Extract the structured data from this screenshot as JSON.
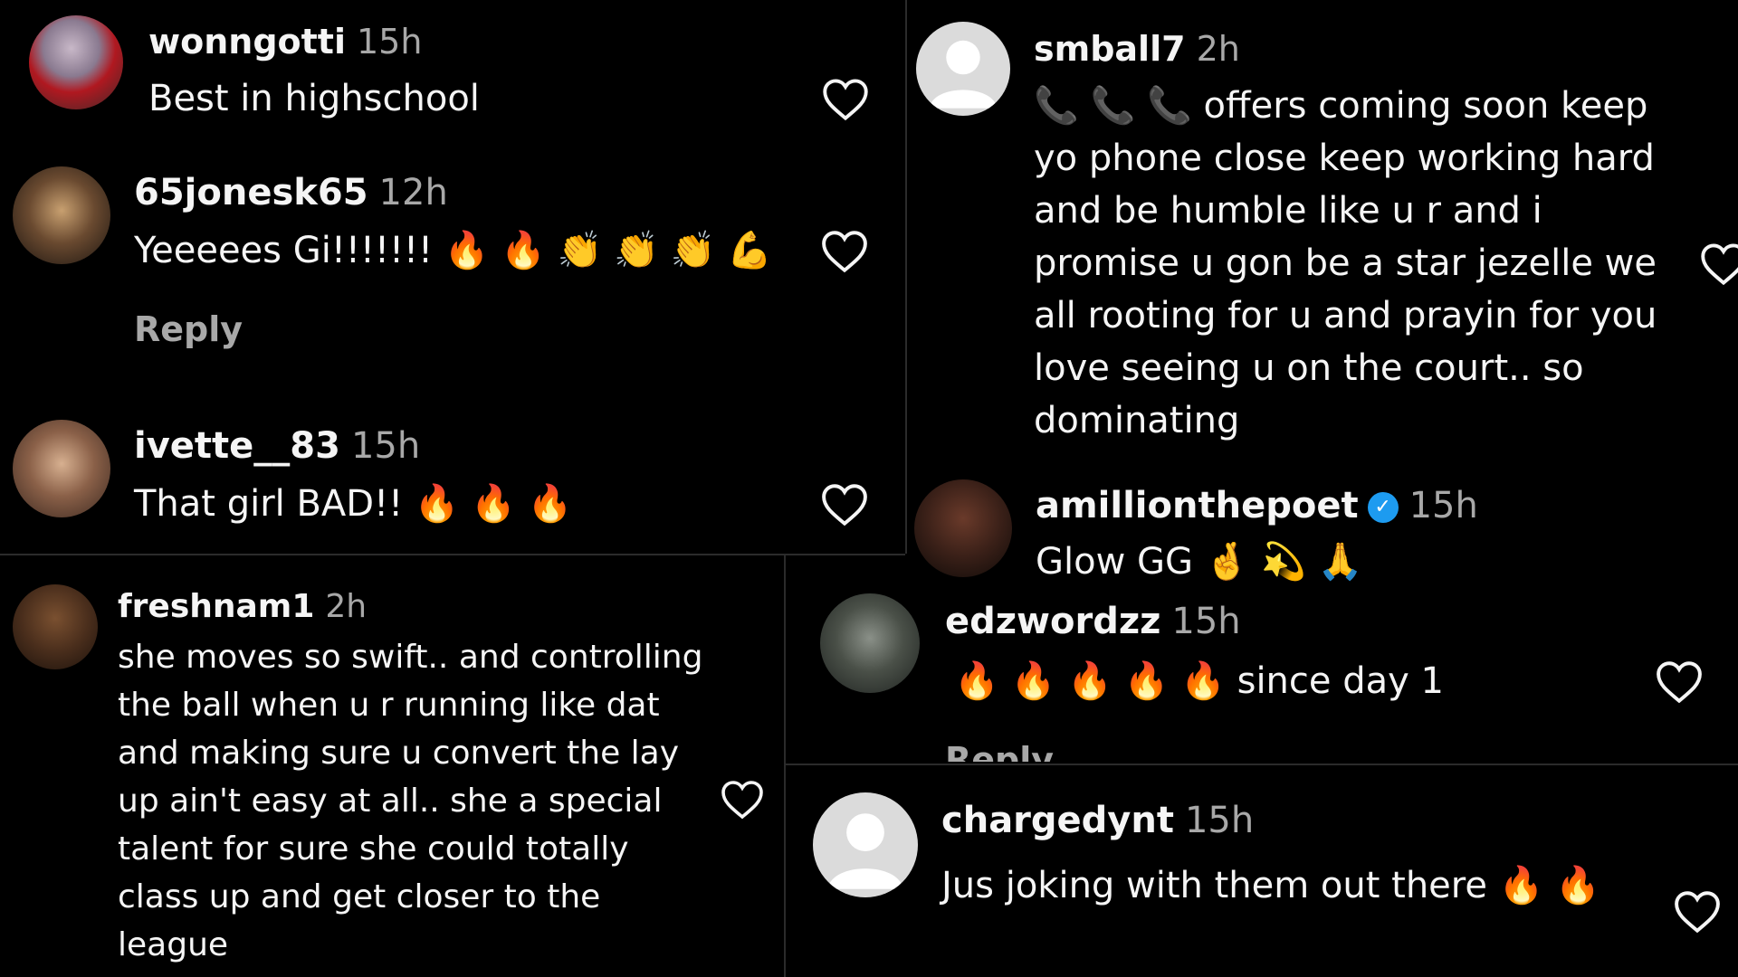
{
  "comments": [
    {
      "username": "wonngotti",
      "time": "15h",
      "text": "Best in highschool"
    },
    {
      "username": "65jonesk65",
      "time": "12h",
      "text": "Yeeeees Gi!!!!!!! 🔥 🔥 👏 👏 👏 💪",
      "reply": "Reply"
    },
    {
      "username": "ivette__83",
      "time": "15h",
      "text": "That girl BAD!! 🔥 🔥 🔥"
    },
    {
      "username": "smball7",
      "time": "2h",
      "text": "📞 📞 📞 offers coming soon keep yo phone close keep working hard and be humble like u r and i promise u gon be a star jezelle we all rooting for u and prayin for you love seeing u on the court.. so dominating"
    },
    {
      "username": "amillionthepoet",
      "time": "15h",
      "text": "Glow GG 🤞 💫 🙏"
    },
    {
      "username": "edzwordzz",
      "time": "15h",
      "text": "🔥 🔥 🔥 🔥 🔥  since day 1",
      "reply": "Reply"
    },
    {
      "username": "freshnam1",
      "time": "2h",
      "text": "she moves so swift.. and controlling the ball when u r running like dat and making sure u convert the lay up ain't easy at all.. she a special talent for sure she could totally class up and get closer to the league"
    },
    {
      "username": "chargedynt",
      "time": "15h",
      "text": "Jus joking with them out there 🔥 🔥"
    }
  ],
  "icons": {
    "like": "heart-outline-icon",
    "verified": "verified-badge-icon",
    "default_avatar": "default-avatar-icon"
  },
  "colors": {
    "background": "#000000",
    "text": "#f5f5f5",
    "secondary": "#a8a8a8",
    "verified": "#1d9bf0"
  }
}
